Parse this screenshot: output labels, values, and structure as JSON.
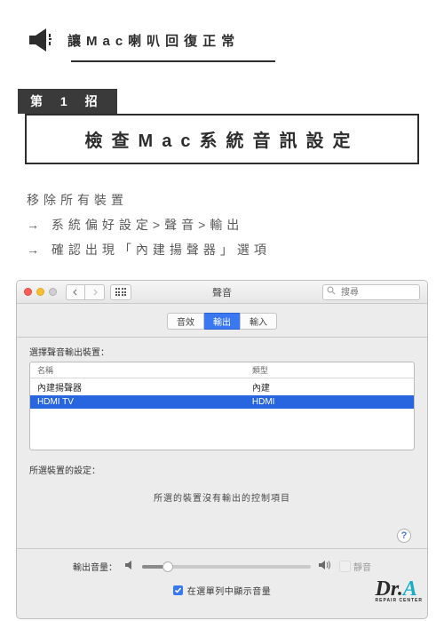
{
  "header": {
    "title": "讓Mac喇叭回復正常"
  },
  "tip": {
    "number": "第 1 招",
    "title": "檢查Mac系統音訊設定"
  },
  "steps": {
    "line1": "移除所有裝置",
    "line2": "→ 系統偏好設定>聲音>輸出",
    "line3": "→ 確認出現「內建揚聲器」選項"
  },
  "window": {
    "title": "聲音",
    "search_placeholder": "搜尋",
    "tabs": [
      "音效",
      "輸出",
      "輸入"
    ],
    "active_tab_index": 1,
    "select_device_label": "選擇聲音輸出裝置：",
    "columns": {
      "name": "名稱",
      "type": "類型"
    },
    "rows": [
      {
        "name": "內建揚聲器",
        "type": "內建",
        "selected": false
      },
      {
        "name": "HDMI TV",
        "type": "HDMI",
        "selected": true
      }
    ],
    "selected_settings_label": "所選裝置的設定：",
    "no_controls": "所選的裝置沒有輸出的控制項目",
    "help_label": "?",
    "volume": {
      "label": "輸出音量：",
      "mute_label": "靜音"
    },
    "menubar_label": "在選單列中顯示音量"
  },
  "logo": {
    "text_prefix": "Dr.",
    "text_accent": "A",
    "subtitle": "REPAIR CENTER"
  }
}
